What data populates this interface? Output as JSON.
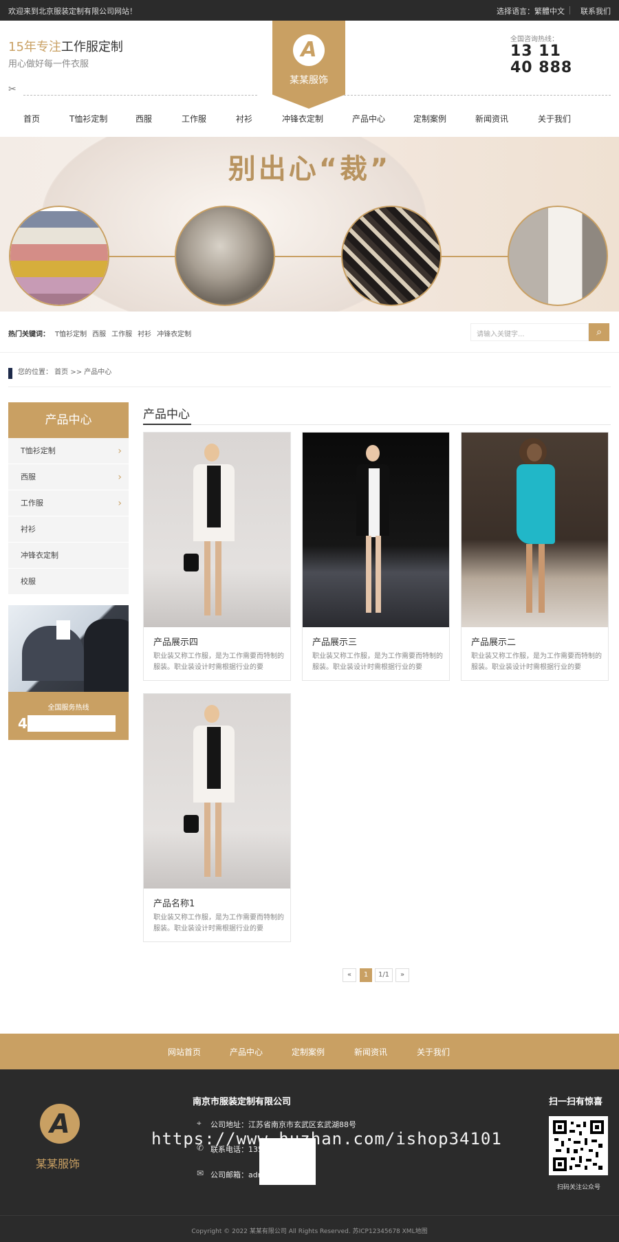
{
  "topbar": {
    "welcome": "欢迎来到北京服装定制有限公司网站！",
    "language": "选择语言：繁體中文",
    "contact": "联系我们"
  },
  "header": {
    "slogan_highlight": "15年专注",
    "slogan_rest": "工作服定制",
    "subtitle": "用心做好每一件衣服",
    "brand": "某某服饰",
    "logo_letter": "A",
    "hotline_label": "全国咨询热线：",
    "hotline_line1": "13      11",
    "hotline_line2": "40    888"
  },
  "nav": [
    "首页",
    "T恤衫定制",
    "西服",
    "工作服",
    "衬衫",
    "冲锋衣定制",
    "产品中心",
    "定制案例",
    "新闻资讯",
    "关于我们"
  ],
  "banner": {
    "title": "别出心“裁”"
  },
  "search": {
    "hot_label": "热门关键词：",
    "keywords": [
      "T恤衫定制",
      "西服",
      "工作服",
      "衬衫",
      "冲锋衣定制"
    ],
    "placeholder": "请输入关键字..."
  },
  "breadcrumb": {
    "text": "您的位置： 首页 >> 产品中心"
  },
  "sidebar": {
    "title": "产品中心",
    "items": [
      {
        "label": "T恤衫定制",
        "arrow": "›"
      },
      {
        "label": "西服",
        "arrow": "›"
      },
      {
        "label": "工作服",
        "arrow": "›"
      },
      {
        "label": "衬衫",
        "arrow": ""
      },
      {
        "label": "冲锋衣定制",
        "arrow": ""
      },
      {
        "label": "校服",
        "arrow": ""
      }
    ],
    "hotline_label": "全国服务热线",
    "hotline_visible": "4                8"
  },
  "main": {
    "title": "产品中心",
    "products": [
      {
        "name": "产品展示四",
        "desc": "职业装又称工作服，是为工作需要而特制的服装。职业装设计时需根据行业的要"
      },
      {
        "name": "产品展示三",
        "desc": "职业装又称工作服，是为工作需要而特制的服装。职业装设计时需根据行业的要"
      },
      {
        "name": "产品展示二",
        "desc": "职业装又称工作服，是为工作需要而特制的服装。职业装设计时需根据行业的要"
      },
      {
        "name": "产品名称1",
        "desc": "职业装又称工作服，是为工作需要而特制的服装。职业装设计时需根据行业的要"
      }
    ],
    "pager": {
      "prev": "«",
      "current": "1",
      "info": "1/1",
      "next": "»"
    }
  },
  "footer_nav": [
    "网站首页",
    "产品中心",
    "定制案例",
    "新闻资讯",
    "关于我们"
  ],
  "footer": {
    "logo_letter": "A",
    "brand": "某某服饰",
    "company": "南京市服装定制有限公司",
    "address": "公司地址：江苏省南京市玄武区玄武湖88号",
    "phone": "联系电话：135        888-8888",
    "email": "公司邮箱：adm          m",
    "qr_title": "扫一扫有惊喜",
    "qr_label": "扫码关注公众号",
    "watermark": "https://www.huzhan.com/ishop34101",
    "copyright": "Copyright © 2022 某某有限公司 All Rights Reserved. 苏ICP12345678 XML地图"
  },
  "colors": {
    "accent": "#c9a063",
    "dark": "#2b2b2b"
  }
}
